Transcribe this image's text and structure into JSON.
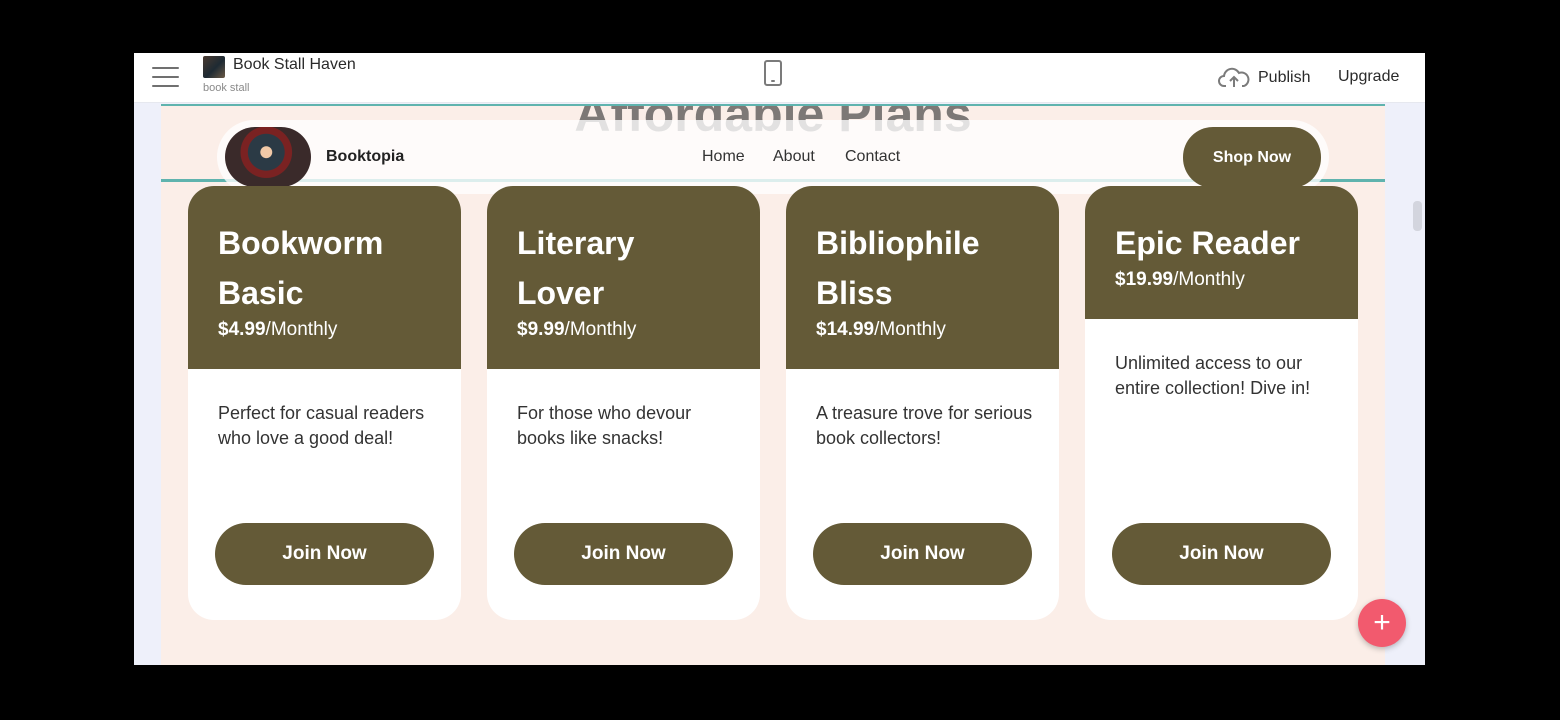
{
  "editor": {
    "site_title": "Book Stall Haven",
    "site_subtitle": "book stall",
    "publish_label": "Publish",
    "upgrade_label": "Upgrade",
    "icons": [
      "menu-icon",
      "mobile-device-icon",
      "cloud-upload-icon",
      "plus-icon"
    ]
  },
  "section": {
    "heading": "Affordable Plans"
  },
  "site_nav": {
    "brand": "Booktopia",
    "links": [
      "Home",
      "About",
      "Contact"
    ],
    "cta": "Shop Now"
  },
  "plans": [
    {
      "title_line1": "Bookworm",
      "title_line2": "Basic",
      "price": "$4.99",
      "period": "/Monthly",
      "description": "Perfect for casual readers who love a good deal!",
      "button": "Join Now"
    },
    {
      "title_line1": "Literary",
      "title_line2": "Lover",
      "price": "$9.99",
      "period": "/Monthly",
      "description": "For those who devour books like snacks!",
      "button": "Join Now"
    },
    {
      "title_line1": "Bibliophile",
      "title_line2": "Bliss",
      "price": "$14.99",
      "period": "/Monthly",
      "description": "A treasure trove for serious book collectors!",
      "button": "Join Now"
    },
    {
      "title_line1": "Epic Reader",
      "title_line2": "",
      "price": "$19.99",
      "period": "/Monthly",
      "description": "Unlimited access to our entire collection! Dive in!",
      "button": "Join Now"
    }
  ],
  "colors": {
    "accent": "#645a37",
    "canvas_bg": "#fbeee8",
    "selection": "#5fb3ae",
    "fab": "#f25a6e"
  }
}
